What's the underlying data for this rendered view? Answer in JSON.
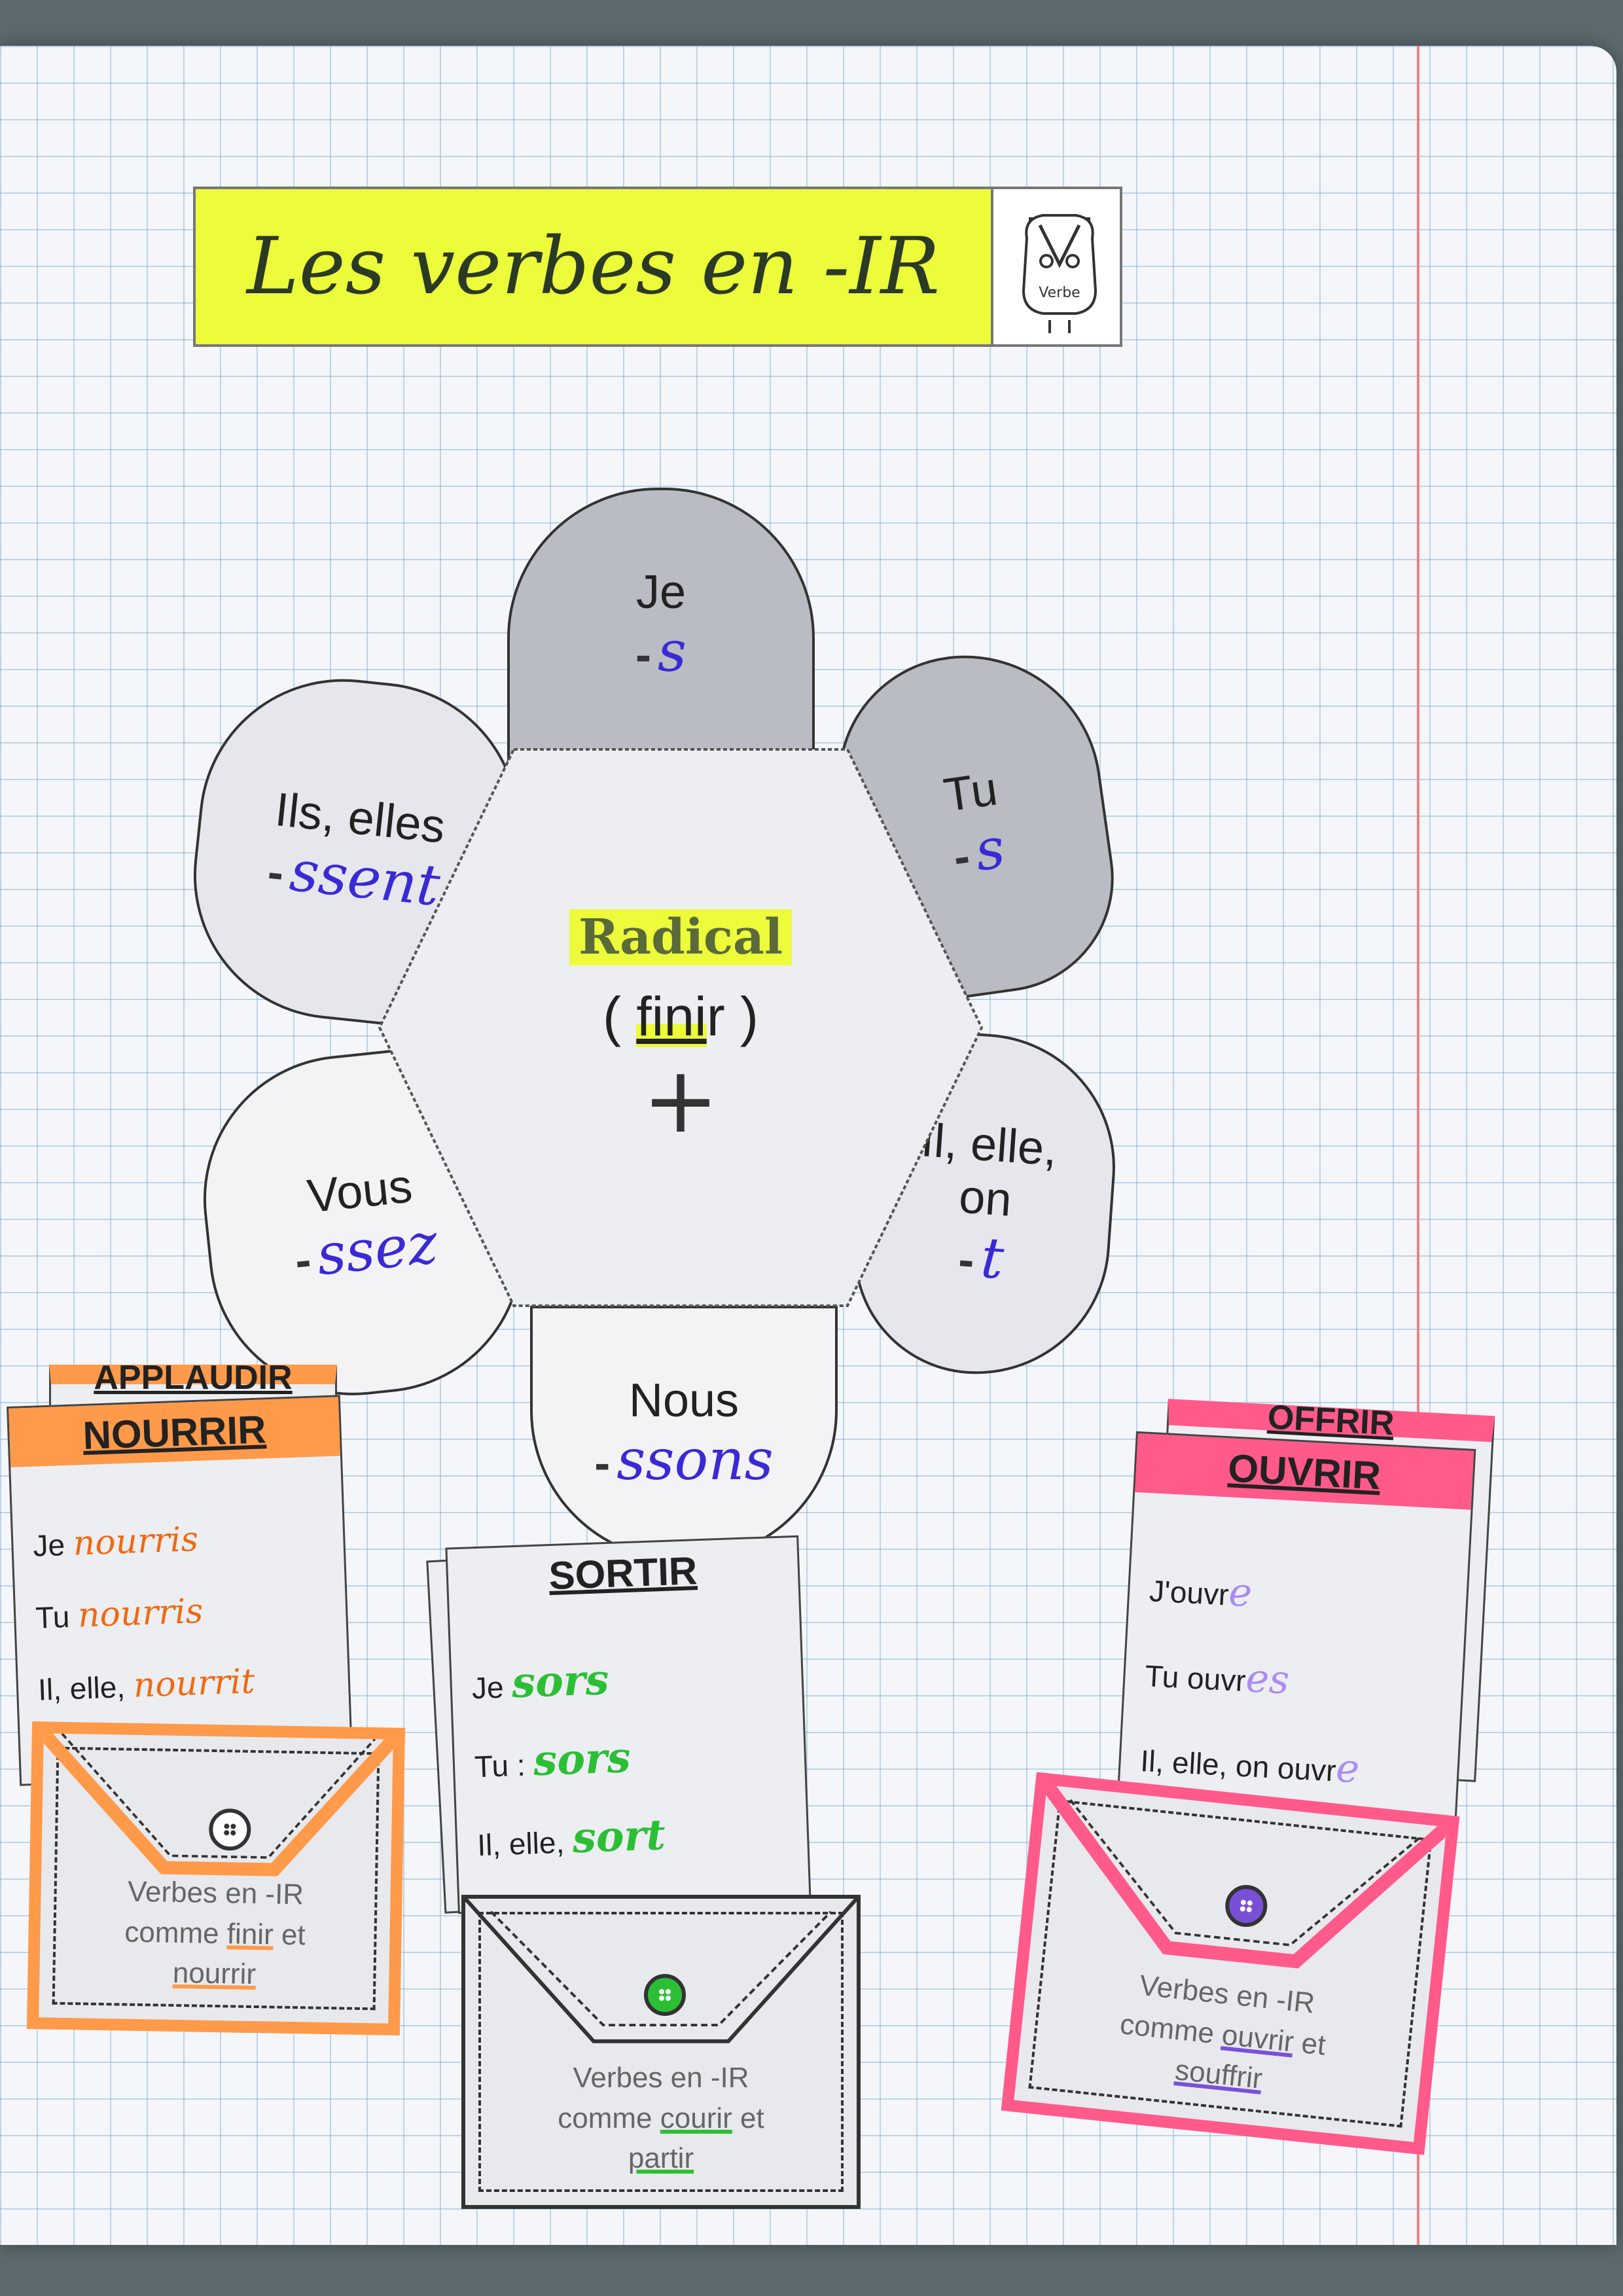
{
  "title": "Les verbes en -IR",
  "mascot_label": "Verbe",
  "flower": {
    "center": {
      "radical": "Radical",
      "example_open": "(",
      "example_stem": "fini",
      "example_end": "r",
      "example_close": ")",
      "plus": "+"
    },
    "petals": [
      {
        "pronoun": "Je",
        "ending": "s"
      },
      {
        "pronoun": "Tu",
        "ending": "s"
      },
      {
        "pronoun": "Il, elle,",
        "pronoun2": "on",
        "ending": "t"
      },
      {
        "pronoun": "Nous",
        "ending": "ssons"
      },
      {
        "pronoun": "Vous",
        "ending": "ssez"
      },
      {
        "pronoun": "Ils, elles",
        "ending": "ssent"
      }
    ],
    "dash": "-"
  },
  "cards": {
    "left": {
      "back_title": "APPLAUDIR",
      "title": "NOURRIR",
      "lines": [
        {
          "p": "Je",
          "v": "nourris"
        },
        {
          "p": "Tu",
          "v": "nourris"
        },
        {
          "p": "Il, elle,",
          "v": "nourrit"
        }
      ],
      "pocket": {
        "line1": "Verbes en -IR",
        "line2": "comme",
        "verb1": "finir",
        "and": "et",
        "verb2": "nourrir"
      },
      "color": "#ff9a4a",
      "text_color": "#f06a10"
    },
    "middle": {
      "title": "SORTIR",
      "lines": [
        {
          "p": "Je",
          "v": "sors"
        },
        {
          "p": "Tu :",
          "v": "sors"
        },
        {
          "p": "Il, elle,",
          "v": "sort"
        }
      ],
      "pocket": {
        "line1": "Verbes en -IR",
        "line2": "comme",
        "verb1": "courir",
        "and": "et",
        "verb2": "partir"
      },
      "color": "#e8e9ed",
      "text_color": "#2cbf35"
    },
    "right": {
      "back_title": "OFFRIR",
      "title": "OUVRIR",
      "lines": [
        {
          "p": "J'ouvr",
          "v": "e"
        },
        {
          "p": "Tu ouvr",
          "v": "es"
        },
        {
          "p": "Il, elle, on ouvr",
          "v": "e"
        }
      ],
      "pocket": {
        "line1": "Verbes en -IR",
        "line2": "comme",
        "verb1": "ouvrir",
        "and": "et",
        "verb2": "souffrir"
      },
      "color": "#ff5a8a",
      "text_color": "#a98cf0"
    }
  }
}
